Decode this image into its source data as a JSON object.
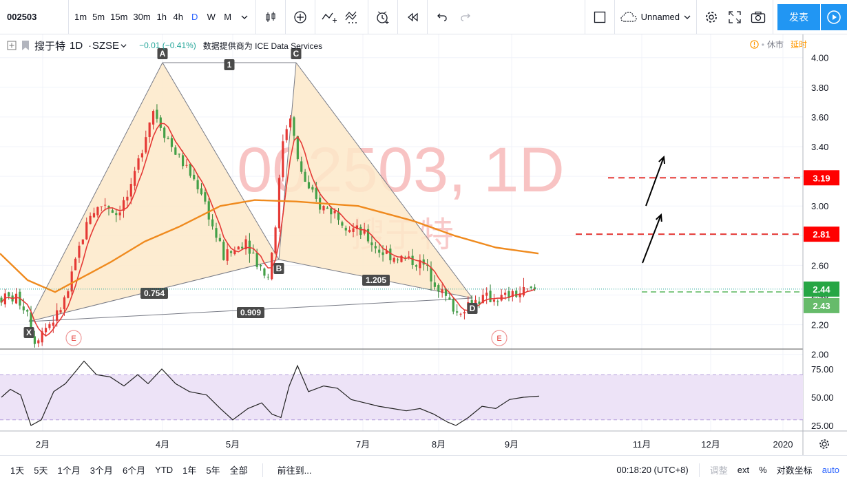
{
  "toolbar": {
    "symbol": "002503",
    "intervals": [
      "1m",
      "5m",
      "15m",
      "30m",
      "1h",
      "4h",
      "D",
      "W",
      "M"
    ],
    "active_interval": "D",
    "layout_name": "Unnamed",
    "publish_label": "发表",
    "icons": [
      "chevron-down-icon",
      "candles-icon",
      "add-compare-icon",
      "indicator-icon",
      "templates-icon",
      "alert-icon",
      "replay-icon",
      "undo-icon",
      "redo-icon",
      "layout-icon",
      "cloud-icon",
      "settings-icon",
      "fullscreen-icon",
      "camera-icon",
      "play-icon"
    ]
  },
  "legend": {
    "symbol_name": "搜于特",
    "interval": "1D",
    "exchange": "SZSE",
    "change": "−0.01 (−0.41%)",
    "vendor": "数据提供商为 ICE Data Services",
    "market_status": "休市",
    "delay": "延时"
  },
  "watermark": {
    "line1": "002503, 1D",
    "line2": "搜于特"
  },
  "colors": {
    "up": "#26a69a",
    "down": "#ef5350",
    "ma_fast": "#e53935",
    "ma_slow": "#ef8a1e",
    "pattern_fill": "#fde9c9",
    "rsi_band": "#ede3f7",
    "target_line": "#e53935",
    "watermark": "#f5b5b5"
  },
  "chart_data": [
    {
      "type": "candlestick",
      "title": "",
      "y_axis": {
        "min": 1.9,
        "max": 4.0,
        "ticks": [
          "4.00",
          "3.80",
          "3.60",
          "3.40",
          "3.20",
          "3.00",
          "2.80",
          "2.60",
          "2.40",
          "2.20",
          "2.00"
        ]
      },
      "x_axis": {
        "ticks": [
          "2月",
          "4月",
          "5月",
          "7月",
          "8月",
          "9月",
          "11月",
          "12月",
          "2020"
        ]
      },
      "price_labels": [
        {
          "value": "3.19",
          "style": "red"
        },
        {
          "value": "2.81",
          "style": "red"
        },
        {
          "value": "2.44",
          "style": "green"
        },
        {
          "value": "2.43",
          "style": "light-green"
        }
      ],
      "harmonic_points": [
        {
          "label": "X",
          "price": 2.05
        },
        {
          "label": "A",
          "price": 3.8
        },
        {
          "label": "B",
          "price": 2.47
        },
        {
          "label": "C",
          "price": 3.8
        },
        {
          "label": "D",
          "price": 2.22
        }
      ],
      "ratios": [
        {
          "label": "1",
          "between": "A-C"
        },
        {
          "label": "0.754",
          "between": "X-B"
        },
        {
          "label": "1.205",
          "between": "B-D"
        },
        {
          "label": "0.909",
          "between": "X-D"
        }
      ],
      "targets": [
        3.19,
        2.81
      ],
      "current_price": 2.44,
      "event_markers": [
        "E",
        "E"
      ]
    },
    {
      "type": "line",
      "title": "",
      "y_axis": {
        "ticks": [
          "75.00",
          "50.00",
          "25.00"
        ]
      },
      "band": [
        30,
        70
      ]
    }
  ],
  "bottombar": {
    "ranges": [
      "1天",
      "5天",
      "1个月",
      "3个月",
      "6个月",
      "YTD",
      "1年",
      "5年",
      "全部"
    ],
    "goto": "前往到...",
    "time": "00:18:20 (UTC+8)",
    "adjust": "调整",
    "ext": "ext",
    "percent": "%",
    "log": "对数坐标",
    "auto": "auto"
  }
}
